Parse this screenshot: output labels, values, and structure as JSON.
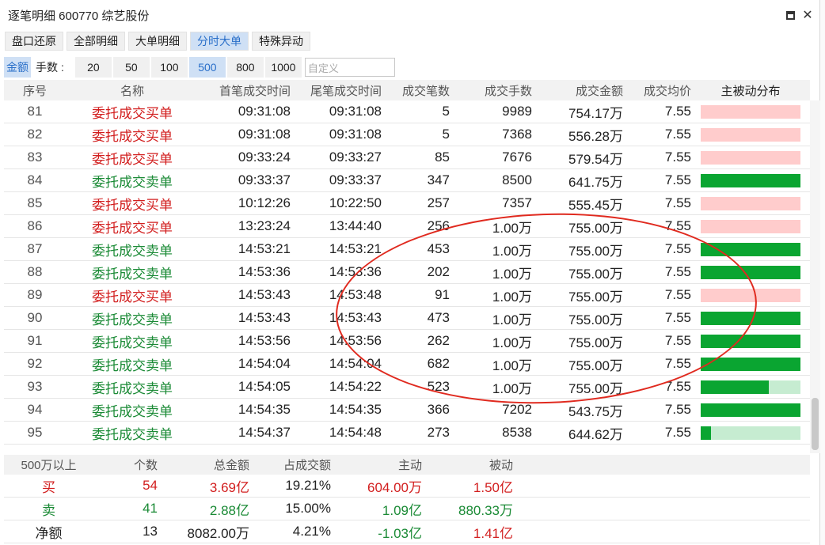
{
  "window": {
    "title": "逐笔明细 600770 综艺股份",
    "minimize_label": "",
    "close_label": "✕"
  },
  "tabs": [
    {
      "label": "盘口还原",
      "active": false
    },
    {
      "label": "全部明细",
      "active": false
    },
    {
      "label": "大单明细",
      "active": false
    },
    {
      "label": "分时大单",
      "active": true
    },
    {
      "label": "特殊异动",
      "active": false
    }
  ],
  "filter": {
    "amount_label": "金额",
    "lots_label": "手数",
    "colon": ":",
    "options": [
      "20",
      "50",
      "100",
      "500",
      "800",
      "1000"
    ],
    "selected": "500",
    "custom_placeholder": "自定义"
  },
  "table": {
    "headers": [
      "序号",
      "名称",
      "首笔成交时间",
      "尾笔成交时间",
      "成交笔数",
      "成交手数",
      "成交金额",
      "成交均价",
      "主被动分布"
    ],
    "rows": [
      {
        "no": "81",
        "name": "委托成交买单",
        "side": "buy",
        "first": "09:31:08",
        "last": "09:31:08",
        "count": "5",
        "lots": "9989",
        "amount": "754.17万",
        "avg": "7.55",
        "active_ratio": 0
      },
      {
        "no": "82",
        "name": "委托成交买单",
        "side": "buy",
        "first": "09:31:08",
        "last": "09:31:08",
        "count": "5",
        "lots": "7368",
        "amount": "556.28万",
        "avg": "7.55",
        "active_ratio": 0
      },
      {
        "no": "83",
        "name": "委托成交买单",
        "side": "buy",
        "first": "09:33:24",
        "last": "09:33:27",
        "count": "85",
        "lots": "7676",
        "amount": "579.54万",
        "avg": "7.55",
        "active_ratio": 0
      },
      {
        "no": "84",
        "name": "委托成交卖单",
        "side": "sell",
        "first": "09:33:37",
        "last": "09:33:37",
        "count": "347",
        "lots": "8500",
        "amount": "641.75万",
        "avg": "7.55",
        "active_ratio": 1
      },
      {
        "no": "85",
        "name": "委托成交买单",
        "side": "buy",
        "first": "10:12:26",
        "last": "10:22:50",
        "count": "257",
        "lots": "7357",
        "amount": "555.45万",
        "avg": "7.55",
        "active_ratio": 0
      },
      {
        "no": "86",
        "name": "委托成交买单",
        "side": "buy",
        "first": "13:23:24",
        "last": "13:44:40",
        "count": "256",
        "lots": "1.00万",
        "amount": "755.00万",
        "avg": "7.55",
        "active_ratio": 0
      },
      {
        "no": "87",
        "name": "委托成交卖单",
        "side": "sell",
        "first": "14:53:21",
        "last": "14:53:21",
        "count": "453",
        "lots": "1.00万",
        "amount": "755.00万",
        "avg": "7.55",
        "active_ratio": 1
      },
      {
        "no": "88",
        "name": "委托成交卖单",
        "side": "sell",
        "first": "14:53:36",
        "last": "14:53:36",
        "count": "202",
        "lots": "1.00万",
        "amount": "755.00万",
        "avg": "7.55",
        "active_ratio": 1
      },
      {
        "no": "89",
        "name": "委托成交买单",
        "side": "buy",
        "first": "14:53:43",
        "last": "14:53:48",
        "count": "91",
        "lots": "1.00万",
        "amount": "755.00万",
        "avg": "7.55",
        "active_ratio": 0
      },
      {
        "no": "90",
        "name": "委托成交卖单",
        "side": "sell",
        "first": "14:53:43",
        "last": "14:53:43",
        "count": "473",
        "lots": "1.00万",
        "amount": "755.00万",
        "avg": "7.55",
        "active_ratio": 1
      },
      {
        "no": "91",
        "name": "委托成交卖单",
        "side": "sell",
        "first": "14:53:56",
        "last": "14:53:56",
        "count": "262",
        "lots": "1.00万",
        "amount": "755.00万",
        "avg": "7.55",
        "active_ratio": 1
      },
      {
        "no": "92",
        "name": "委托成交卖单",
        "side": "sell",
        "first": "14:54:04",
        "last": "14:54:04",
        "count": "682",
        "lots": "1.00万",
        "amount": "755.00万",
        "avg": "7.55",
        "active_ratio": 1
      },
      {
        "no": "93",
        "name": "委托成交卖单",
        "side": "sell",
        "first": "14:54:05",
        "last": "14:54:22",
        "count": "523",
        "lots": "1.00万",
        "amount": "755.00万",
        "avg": "7.55",
        "active_ratio": 0.68
      },
      {
        "no": "94",
        "name": "委托成交卖单",
        "side": "sell",
        "first": "14:54:35",
        "last": "14:54:35",
        "count": "366",
        "lots": "7202",
        "amount": "543.75万",
        "avg": "7.55",
        "active_ratio": 1
      },
      {
        "no": "95",
        "name": "委托成交卖单",
        "side": "sell",
        "first": "14:54:37",
        "last": "14:54:48",
        "count": "273",
        "lots": "8538",
        "amount": "644.62万",
        "avg": "7.55",
        "active_ratio": 0.1
      }
    ]
  },
  "summary": {
    "headers": [
      "500万以上",
      "个数",
      "总金额",
      "占成交额",
      "主动",
      "被动"
    ],
    "rows": [
      {
        "label": "买",
        "tone": "red",
        "count": "54",
        "total": "3.69亿",
        "pct": "19.21%",
        "active": "604.00万",
        "passive": "1.50亿",
        "active_tone": "red",
        "passive_tone": "red"
      },
      {
        "label": "卖",
        "tone": "green",
        "count": "41",
        "total": "2.88亿",
        "pct": "15.00%",
        "active": "1.09亿",
        "passive": "880.33万",
        "active_tone": "green",
        "passive_tone": "green"
      },
      {
        "label": "净额",
        "tone": "black",
        "count": "13",
        "total": "8082.00万",
        "pct": "4.21%",
        "active": "-1.03亿",
        "passive": "1.41亿",
        "active_tone": "green",
        "passive_tone": "red"
      }
    ]
  },
  "colors": {
    "buy_bar": "#ffcccc",
    "sell_bar": "#0aa531",
    "sell_bar_bg": "#c6ecd1",
    "annotation_circle": "#e02a1f"
  }
}
